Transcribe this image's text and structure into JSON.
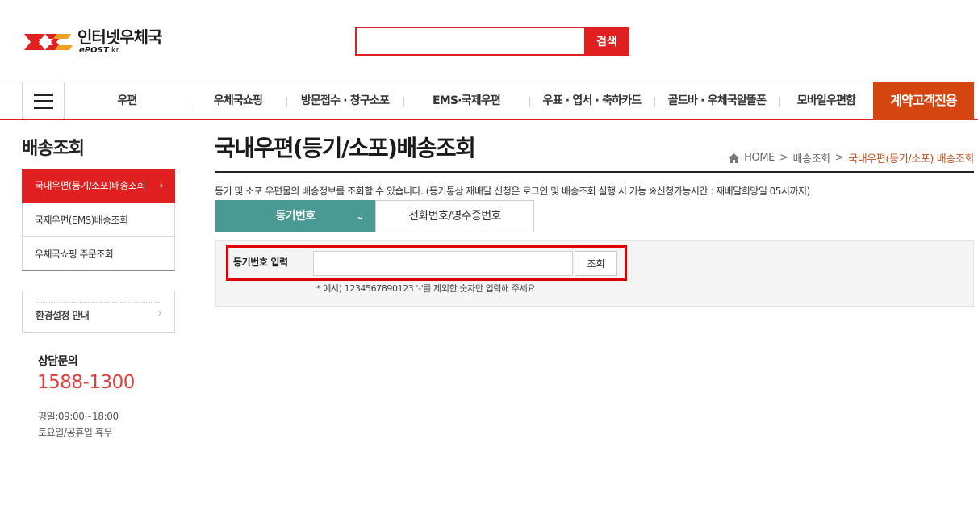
{
  "header": {
    "logo_text": "인터넷우체국",
    "logo_sub": "ePOST",
    "logo_domain": ".kr",
    "search_button": "검색",
    "search_value": ""
  },
  "colors": {
    "accent": "#e02020",
    "special": "#d4450f",
    "tab_active": "#4a9a94",
    "phone": "#e04040",
    "breadcrumb_current": "#c0572a"
  },
  "gnb": {
    "menu_icon": "hamburger-icon",
    "items": [
      "우편",
      "우체국쇼핑",
      "방문접수 · 창구소포",
      "EMS·국제우편",
      "우표 · 엽서 · 축하카드",
      "골드바 · 우체국알뜰폰",
      "모바일우편함"
    ],
    "special": "계약고객전용"
  },
  "sidebar": {
    "title": "배송조회",
    "items": [
      {
        "label": "국내우편(등기/소포)배송조회",
        "arrow": "›"
      },
      {
        "label": "국제우편(EMS)배송조회"
      },
      {
        "label": "우체국쇼핑 주문조회"
      }
    ],
    "env": {
      "label": "환경설정 안내",
      "arrow": "›"
    },
    "cs": {
      "label": "상담문의",
      "phone": "1588-1300",
      "weekday": "평일:09:00~18:00",
      "holiday": "토요일/공휴일 휴무"
    }
  },
  "main": {
    "title": "국내우편(등기/소포)배송조회",
    "breadcrumb": {
      "home": "HOME",
      "sep": ">",
      "level1": "배송조회",
      "current": "국내우편(등기/소포) 배송조회"
    },
    "description": "등기 및 소포 우편물의 배송정보를 조회할 수 있습니다. (등기통상 재배달 신청은 로그인 및 배송조회 실행 시 가능 ※신청가능시간 : 재배달희망일 05시까지)",
    "tabs": [
      {
        "label": "등기번호",
        "chevron": "⌄"
      },
      {
        "label": "전화번호/영수증번호"
      }
    ],
    "form": {
      "label": "등기번호 입력",
      "value": "",
      "button": "조회",
      "hint": "* 예시) 1234567890123 '-'를 제외한 숫자만 입력해 주세요"
    }
  }
}
